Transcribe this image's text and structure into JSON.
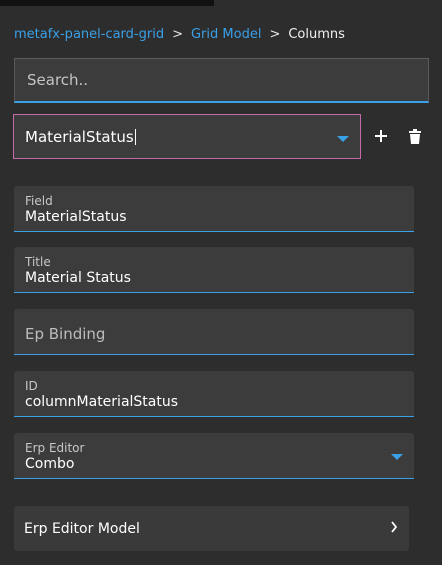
{
  "breadcrumb": {
    "item1": "metafx-panel-card-grid",
    "sep1": ">",
    "item2": "Grid Model",
    "sep2": ">",
    "current": "Columns"
  },
  "search": {
    "placeholder": "Search.."
  },
  "column_select": {
    "value": "MaterialStatus"
  },
  "fields": {
    "field": {
      "label": "Field",
      "value": "MaterialStatus"
    },
    "title": {
      "label": "Title",
      "value": "Material Status"
    },
    "ep_binding": {
      "placeholder": "Ep Binding"
    },
    "id": {
      "label": "ID",
      "value": "columnMaterialStatus"
    },
    "erp_editor": {
      "label": "Erp Editor",
      "value": "Combo"
    }
  },
  "panel": {
    "title": "Erp Editor Model"
  },
  "icons": {
    "add": "plus-icon",
    "delete": "trash-icon",
    "dropdown": "caret-down-icon",
    "expand": "chevron-right-icon"
  },
  "colors": {
    "background": "#2d2d2d",
    "field_bg": "#3c3c3c",
    "accent": "#3aa0e8",
    "focus_border": "#c46aa8"
  }
}
